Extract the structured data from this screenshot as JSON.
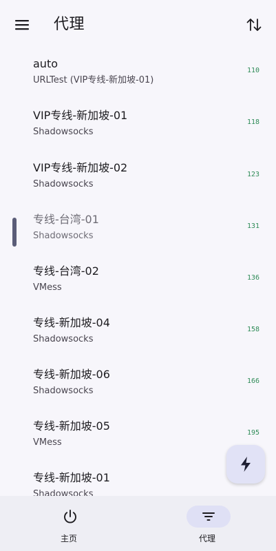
{
  "header": {
    "title": "代理",
    "menu_icon": "menu-icon",
    "sort_icon": "sort-icon"
  },
  "proxies": [
    {
      "name": "auto",
      "type": "URLTest (VIP专线-新加坡-01)",
      "latency": "110",
      "selected": false
    },
    {
      "name": "VIP专线-新加坡-01",
      "type": "Shadowsocks",
      "latency": "118",
      "selected": false
    },
    {
      "name": "VIP专线-新加坡-02",
      "type": "Shadowsocks",
      "latency": "123",
      "selected": false
    },
    {
      "name": "专线-台湾-01",
      "type": "Shadowsocks",
      "latency": "131",
      "selected": true
    },
    {
      "name": "专线-台湾-02",
      "type": "VMess",
      "latency": "136",
      "selected": false
    },
    {
      "name": "专线-新加坡-04",
      "type": "Shadowsocks",
      "latency": "158",
      "selected": false
    },
    {
      "name": "专线-新加坡-06",
      "type": "Shadowsocks",
      "latency": "166",
      "selected": false
    },
    {
      "name": "专线-新加坡-05",
      "type": "VMess",
      "latency": "195",
      "selected": false
    },
    {
      "name": "专线-新加坡-01",
      "type": "Shadowsocks",
      "latency": "",
      "selected": false
    }
  ],
  "fab": {
    "icon": "bolt-icon"
  },
  "bottom_nav": {
    "home_label": "主页",
    "proxy_label": "代理",
    "active": "proxy"
  },
  "colors": {
    "background": "#f7f6fb",
    "latency": "#2e8b57",
    "selection_bar": "#5b5d78",
    "nav_active_pill": "#dfe0f5"
  }
}
